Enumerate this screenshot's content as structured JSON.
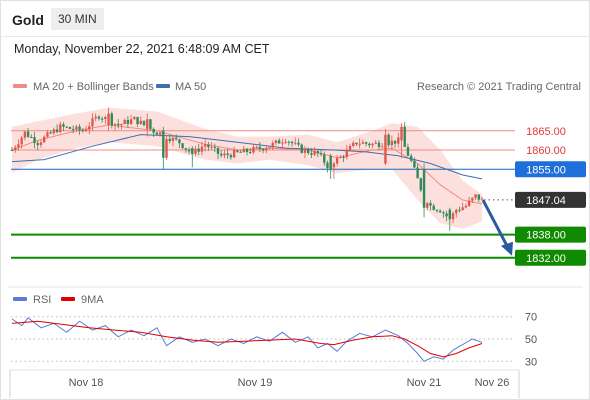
{
  "header": {
    "instrument": "Gold",
    "timeframe": "30 MIN",
    "datetime": "Monday, November 22, 2021 6:48:09 AM CET"
  },
  "colors": {
    "up_candle": "#e2574c",
    "down_candle": "#2e8b57",
    "bollinger_band": "#fbd5d3",
    "ma20": "#f28b82",
    "ma50": "#3e6fb0",
    "support": "#108a00",
    "pivot": "#1565c0",
    "resistance": "#f28b82",
    "arrow": "#2a5aa0",
    "rsi": "#5b7bd5",
    "rsi_ma": "#e00000"
  },
  "chart_data": [
    {
      "type": "candlestick",
      "title": "Gold",
      "legend": [
        {
          "label": "MA 20 + Bollinger Bands",
          "color": "#f28b82"
        },
        {
          "label": "MA 50",
          "color": "#3e6fb0"
        }
      ],
      "legend_position": "top-left",
      "credit": "Research © 2021 Trading Central",
      "x_ticks": [
        "Nov 18",
        "Nov 19",
        "Nov 21",
        "Nov 26"
      ],
      "ylim": [
        1827,
        1873
      ],
      "levels": [
        {
          "value": 1865.0,
          "label": "1865.00",
          "role": "resistance"
        },
        {
          "value": 1860.0,
          "label": "1860.00",
          "role": "resistance"
        },
        {
          "value": 1855.0,
          "label": "1855.00",
          "role": "pivot"
        },
        {
          "value": 1847.04,
          "label": "1847.04",
          "role": "last"
        },
        {
          "value": 1838.0,
          "label": "1838.00",
          "role": "support"
        },
        {
          "value": 1832.0,
          "label": "1832.00",
          "role": "support"
        }
      ],
      "forecast_arrow": {
        "from": 1847.0,
        "to": 1832.0,
        "direction": "down"
      },
      "ma20_bands": [
        {
          "x": 0,
          "ma": 1860.0,
          "upper": 1866.0,
          "lower": 1854.0
        },
        {
          "x": 8,
          "ma": 1862.5,
          "upper": 1867.5,
          "lower": 1857.5
        },
        {
          "x": 20,
          "ma": 1865.0,
          "upper": 1869.5,
          "lower": 1860.5
        },
        {
          "x": 30,
          "ma": 1866.5,
          "upper": 1871.0,
          "lower": 1862.0
        },
        {
          "x": 45,
          "ma": 1865.0,
          "upper": 1870.0,
          "lower": 1861.0
        },
        {
          "x": 60,
          "ma": 1861.5,
          "upper": 1865.5,
          "lower": 1857.5
        },
        {
          "x": 70,
          "ma": 1860.0,
          "upper": 1863.5,
          "lower": 1856.5
        },
        {
          "x": 80,
          "ma": 1860.5,
          "upper": 1863.5,
          "lower": 1857.5
        },
        {
          "x": 92,
          "ma": 1860.0,
          "upper": 1864.0,
          "lower": 1856.0
        },
        {
          "x": 101,
          "ma": 1858.0,
          "upper": 1862.0,
          "lower": 1854.0
        },
        {
          "x": 112,
          "ma": 1860.0,
          "upper": 1865.0,
          "lower": 1855.0
        },
        {
          "x": 118,
          "ma": 1860.5,
          "upper": 1867.0,
          "lower": 1855.0
        },
        {
          "x": 126,
          "ma": 1856.5,
          "upper": 1866.0,
          "lower": 1847.0
        },
        {
          "x": 133,
          "ma": 1851.0,
          "upper": 1860.0,
          "lower": 1841.0
        },
        {
          "x": 140,
          "ma": 1847.0,
          "upper": 1852.0,
          "lower": 1839.5
        },
        {
          "x": 146,
          "ma": 1846.0,
          "upper": 1848.5,
          "lower": 1841.5
        }
      ],
      "ma50": [
        {
          "x": 0,
          "y": 1857.0
        },
        {
          "x": 10,
          "y": 1857.5
        },
        {
          "x": 25,
          "y": 1861.0
        },
        {
          "x": 40,
          "y": 1864.0
        },
        {
          "x": 55,
          "y": 1863.5
        },
        {
          "x": 70,
          "y": 1862.0
        },
        {
          "x": 85,
          "y": 1860.5
        },
        {
          "x": 100,
          "y": 1860.0
        },
        {
          "x": 110,
          "y": 1859.5
        },
        {
          "x": 120,
          "y": 1858.5
        },
        {
          "x": 130,
          "y": 1856.5
        },
        {
          "x": 140,
          "y": 1853.5
        },
        {
          "x": 146,
          "y": 1852.5
        }
      ],
      "price_keypoints": [
        {
          "x": 0,
          "y": 1860.0
        },
        {
          "x": 4,
          "y": 1864.5
        },
        {
          "x": 8,
          "y": 1862.0
        },
        {
          "x": 15,
          "y": 1866.0
        },
        {
          "x": 22,
          "y": 1865.0
        },
        {
          "x": 27,
          "y": 1869.0
        },
        {
          "x": 33,
          "y": 1866.5
        },
        {
          "x": 38,
          "y": 1868.0
        },
        {
          "x": 44,
          "y": 1865.0
        },
        {
          "x": 47,
          "y": 1864.0
        },
        {
          "x": 52,
          "y": 1862.0
        },
        {
          "x": 56,
          "y": 1859.0
        },
        {
          "x": 60,
          "y": 1861.5
        },
        {
          "x": 65,
          "y": 1858.5
        },
        {
          "x": 72,
          "y": 1859.5
        },
        {
          "x": 80,
          "y": 1861.0
        },
        {
          "x": 85,
          "y": 1863.0
        },
        {
          "x": 90,
          "y": 1860.0
        },
        {
          "x": 95,
          "y": 1859.0
        },
        {
          "x": 98,
          "y": 1856.0
        },
        {
          "x": 102,
          "y": 1858.0
        },
        {
          "x": 107,
          "y": 1862.0
        },
        {
          "x": 112,
          "y": 1861.5
        },
        {
          "x": 117,
          "y": 1862.0
        },
        {
          "x": 121,
          "y": 1862.5
        },
        {
          "x": 124,
          "y": 1857.0
        },
        {
          "x": 127,
          "y": 1850.0
        },
        {
          "x": 130,
          "y": 1845.5
        },
        {
          "x": 133,
          "y": 1844.5
        },
        {
          "x": 136,
          "y": 1842.0
        },
        {
          "x": 138,
          "y": 1844.5
        },
        {
          "x": 141,
          "y": 1845.5
        },
        {
          "x": 144,
          "y": 1848.0
        },
        {
          "x": 146,
          "y": 1847.0
        }
      ],
      "candles": [
        {
          "x": 30,
          "o": 1866.5,
          "c": 1869.5,
          "h": 1871.0,
          "l": 1865.0
        },
        {
          "x": 42,
          "o": 1865.5,
          "c": 1868.0,
          "h": 1869.5,
          "l": 1863.5
        },
        {
          "x": 47,
          "o": 1865.0,
          "c": 1858.0,
          "h": 1866.0,
          "l": 1855.0
        },
        {
          "x": 56,
          "o": 1860.5,
          "c": 1859.0,
          "h": 1861.0,
          "l": 1855.5
        },
        {
          "x": 99,
          "o": 1858.5,
          "c": 1855.0,
          "h": 1859.0,
          "l": 1852.5
        },
        {
          "x": 100,
          "o": 1855.5,
          "c": 1856.5,
          "h": 1857.0,
          "l": 1852.5
        },
        {
          "x": 116,
          "o": 1856.5,
          "c": 1864.0,
          "h": 1865.5,
          "l": 1856.0
        },
        {
          "x": 121,
          "o": 1862.5,
          "c": 1866.0,
          "h": 1867.0,
          "l": 1858.0
        },
        {
          "x": 128,
          "o": 1855.0,
          "c": 1845.0,
          "h": 1856.5,
          "l": 1842.5
        },
        {
          "x": 136,
          "o": 1844.5,
          "c": 1842.0,
          "h": 1845.0,
          "l": 1839.0
        }
      ]
    },
    {
      "type": "line",
      "title": "RSI",
      "legend": [
        {
          "label": "RSI",
          "color": "#5b7bd5"
        },
        {
          "label": "9MA",
          "color": "#e00000"
        }
      ],
      "ylim": [
        24,
        76
      ],
      "y_ticks": [
        70,
        50,
        30
      ],
      "series": [
        {
          "name": "RSI",
          "points": [
            {
              "x": 0,
              "y": 68
            },
            {
              "x": 3,
              "y": 62
            },
            {
              "x": 5,
              "y": 69
            },
            {
              "x": 9,
              "y": 60
            },
            {
              "x": 13,
              "y": 64
            },
            {
              "x": 17,
              "y": 56
            },
            {
              "x": 21,
              "y": 66
            },
            {
              "x": 25,
              "y": 58
            },
            {
              "x": 29,
              "y": 62
            },
            {
              "x": 33,
              "y": 52
            },
            {
              "x": 37,
              "y": 58
            },
            {
              "x": 41,
              "y": 53
            },
            {
              "x": 45,
              "y": 60
            },
            {
              "x": 48,
              "y": 44
            },
            {
              "x": 52,
              "y": 52
            },
            {
              "x": 56,
              "y": 47
            },
            {
              "x": 60,
              "y": 50
            },
            {
              "x": 64,
              "y": 44
            },
            {
              "x": 68,
              "y": 50
            },
            {
              "x": 72,
              "y": 46
            },
            {
              "x": 76,
              "y": 52
            },
            {
              "x": 80,
              "y": 48
            },
            {
              "x": 84,
              "y": 56
            },
            {
              "x": 88,
              "y": 47
            },
            {
              "x": 92,
              "y": 52
            },
            {
              "x": 95,
              "y": 42
            },
            {
              "x": 98,
              "y": 46
            },
            {
              "x": 101,
              "y": 39
            },
            {
              "x": 104,
              "y": 48
            },
            {
              "x": 108,
              "y": 55
            },
            {
              "x": 112,
              "y": 52
            },
            {
              "x": 116,
              "y": 58
            },
            {
              "x": 120,
              "y": 53
            },
            {
              "x": 123,
              "y": 46
            },
            {
              "x": 126,
              "y": 37
            },
            {
              "x": 128,
              "y": 30
            },
            {
              "x": 131,
              "y": 34
            },
            {
              "x": 134,
              "y": 32
            },
            {
              "x": 137,
              "y": 40
            },
            {
              "x": 140,
              "y": 45
            },
            {
              "x": 143,
              "y": 50
            },
            {
              "x": 146,
              "y": 47
            }
          ]
        },
        {
          "name": "9MA",
          "points": [
            {
              "x": 0,
              "y": 64
            },
            {
              "x": 8,
              "y": 66
            },
            {
              "x": 16,
              "y": 63
            },
            {
              "x": 24,
              "y": 60
            },
            {
              "x": 32,
              "y": 58
            },
            {
              "x": 40,
              "y": 56
            },
            {
              "x": 48,
              "y": 52
            },
            {
              "x": 56,
              "y": 49
            },
            {
              "x": 64,
              "y": 47
            },
            {
              "x": 72,
              "y": 48
            },
            {
              "x": 80,
              "y": 49
            },
            {
              "x": 88,
              "y": 50
            },
            {
              "x": 96,
              "y": 46
            },
            {
              "x": 100,
              "y": 45
            },
            {
              "x": 106,
              "y": 49
            },
            {
              "x": 112,
              "y": 52
            },
            {
              "x": 118,
              "y": 53
            },
            {
              "x": 122,
              "y": 50
            },
            {
              "x": 126,
              "y": 44
            },
            {
              "x": 130,
              "y": 37
            },
            {
              "x": 134,
              "y": 34
            },
            {
              "x": 138,
              "y": 37
            },
            {
              "x": 142,
              "y": 42
            },
            {
              "x": 146,
              "y": 46
            }
          ]
        }
      ]
    }
  ]
}
